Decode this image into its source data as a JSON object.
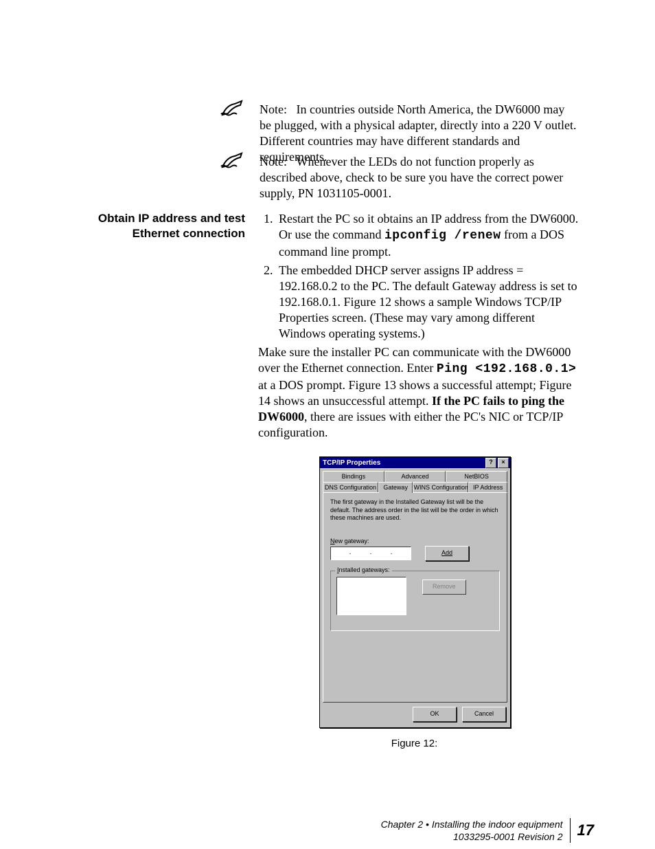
{
  "notes": {
    "note1": {
      "prefix": "Note:",
      "text": "In countries outside North America, the DW6000 may be plugged, with a physical adapter, directly into a 220 V outlet. Different countries may have different standards and requirements."
    },
    "note2": {
      "prefix": "Note:",
      "text": "Whenever the LEDs do not function properly as described above, check to be sure you have the correct power supply, PN 1031105-0001."
    }
  },
  "section_heading": "Obtain IP address and test Ethernet connection",
  "steps": {
    "s1_a": "Restart the PC so it obtains an IP address from the DW6000. Or use the command ",
    "s1_cmd": "ipconfig /renew",
    "s1_b": " from a DOS command line prompt.",
    "s2": "The embedded DHCP server assigns IP address = 192.168.0.2 to the PC. The default Gateway address is set to 192.168.0.1. Figure 12 shows a sample Windows TCP/IP Properties screen. (These may vary among different Windows operating systems.)"
  },
  "para": {
    "a": "Make sure the installer PC can communicate with the DW6000 over the Ethernet connection. Enter ",
    "cmd": "Ping <192.168.0.1>",
    "b": " at a DOS prompt. Figure 13 shows a successful attempt; Figure 14 shows an unsuccessful attempt. ",
    "bold": "If the PC fails to ping the DW6000",
    "c": ", there are issues with either the PC's NIC or TCP/IP configuration."
  },
  "dialog": {
    "title": "TCP/IP Properties",
    "help_btn": "?",
    "close_btn": "×",
    "tabs_row1": [
      "Bindings",
      "Advanced",
      "NetBIOS"
    ],
    "tabs_row2": [
      "DNS Configuration",
      "Gateway",
      "WINS Configuration",
      "IP Address"
    ],
    "active_tab": "Gateway",
    "panel_text": "The first gateway in the Installed Gateway list will be the default. The address order in the list will be the order in which these machines are used.",
    "new_gateway_label": "New gateway:",
    "add_btn": "Add",
    "installed_label": "Installed gateways:",
    "remove_btn": "Remove",
    "ok_btn": "OK",
    "cancel_btn": "Cancel"
  },
  "figure_caption": "Figure 12:",
  "footer": {
    "line1": "Chapter 2 • Installing the indoor equipment",
    "line2": "1033295-0001  Revision 2",
    "page": "17"
  }
}
